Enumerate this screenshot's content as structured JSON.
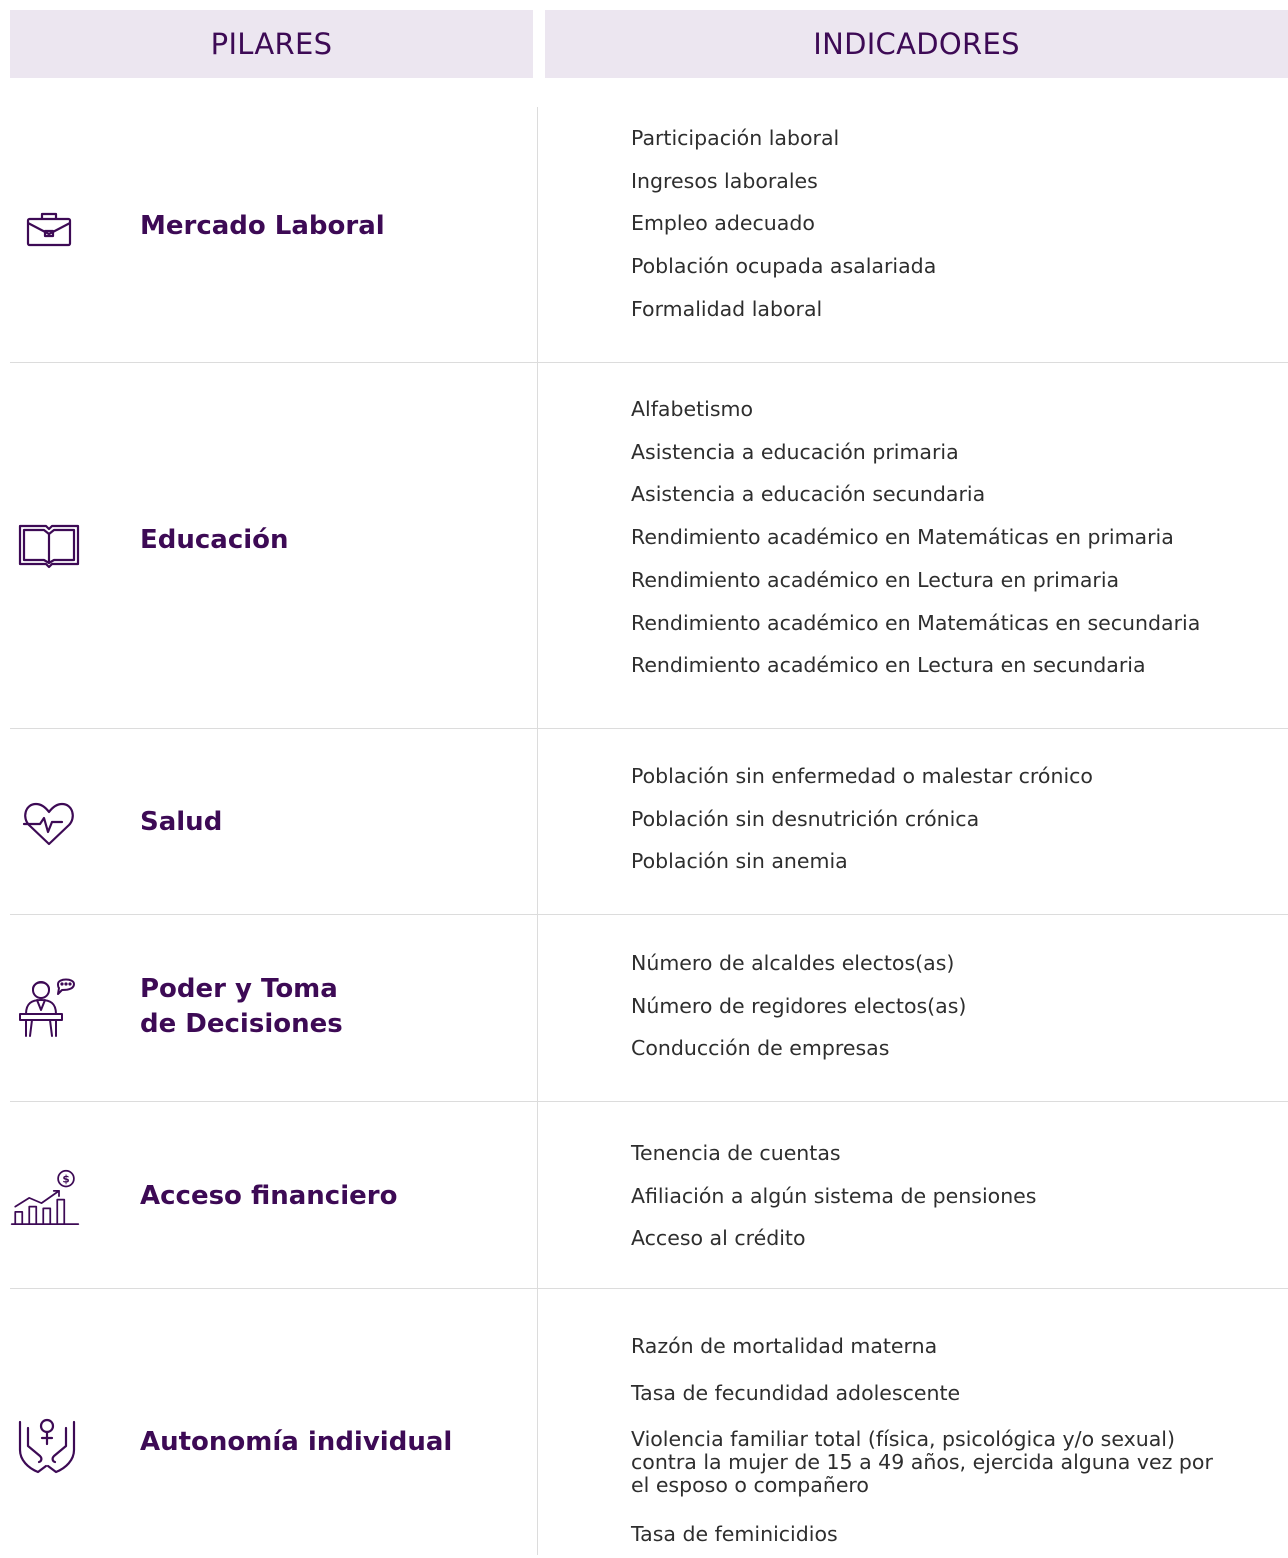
{
  "header": {
    "pilares": "PILARES",
    "indicadores": "INDICADORES"
  },
  "colors": {
    "accent": "#3d0a55",
    "header_bg": "#ece6f0",
    "text": "#2e2e2e",
    "divider": "#dcdcdc"
  },
  "pillars": [
    {
      "icon": "briefcase-icon",
      "title": "Mercado Laboral",
      "indicators": [
        "Participación laboral",
        "Ingresos laborales",
        "Empleo adecuado",
        "Población ocupada asalariada",
        "Formalidad laboral"
      ]
    },
    {
      "icon": "book-icon",
      "title": "Educación",
      "indicators": [
        "Alfabetismo",
        "Asistencia a educación primaria",
        "Asistencia a educación secundaria",
        "Rendimiento académico en Matemáticas en primaria",
        "Rendimiento académico en Lectura en primaria",
        "Rendimiento académico en Matemáticas en secundaria",
        "Rendimiento académico en Lectura en secundaria"
      ]
    },
    {
      "icon": "heart-pulse-icon",
      "title": "Salud",
      "indicators": [
        "Población sin enfermedad o malestar crónico",
        "Población sin desnutrición crónica",
        "Población sin anemia"
      ]
    },
    {
      "icon": "speaker-podium-icon",
      "title_line1": "Poder y Toma",
      "title_line2": "de Decisiones",
      "indicators": [
        "Número de alcaldes electos(as)",
        "Número de regidores electos(as)",
        "Conducción de empresas"
      ]
    },
    {
      "icon": "financial-growth-icon",
      "title": "Acceso financiero",
      "indicators": [
        "Tenencia de cuentas",
        "Afiliación a algún sistema de pensiones",
        "Acceso al crédito"
      ]
    },
    {
      "icon": "hands-female-symbol-icon",
      "title": "Autonomía individual",
      "indicators": [
        "Razón de mortalidad materna",
        "Tasa de fecundidad adolescente",
        "Violencia familiar total (física, psicológica y/o sexual) contra la mujer de 15 a 49 años, ejercida alguna vez por el esposo o compañero",
        "Tasa de feminicidios"
      ]
    }
  ]
}
